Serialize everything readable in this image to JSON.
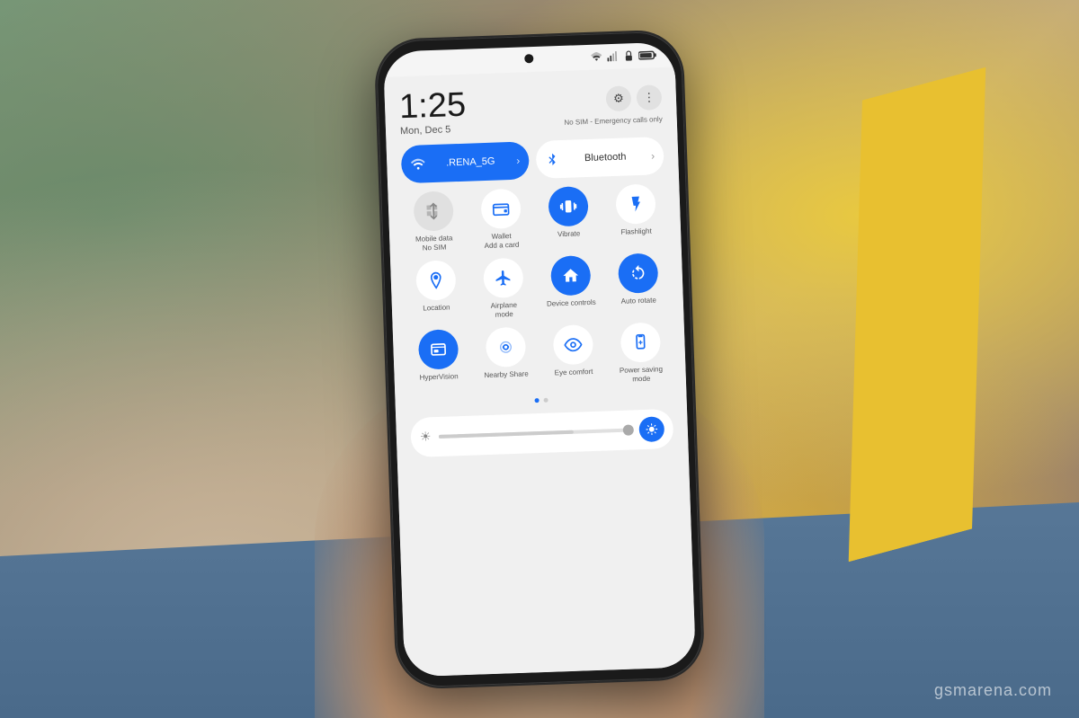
{
  "background": {
    "colors": {
      "main": "#7a8a70",
      "yellow": "#e8c030",
      "blue_floor": "#5a7a9a",
      "hand": "#c8a888"
    }
  },
  "watermark": {
    "text": "gsmarena.com"
  },
  "phone": {
    "status_bar": {
      "icons": [
        "wifi",
        "signal",
        "lock",
        "battery"
      ]
    },
    "quick_settings": {
      "time": "1:25",
      "date": "Mon, Dec 5",
      "sim_info": "No SIM - Emergency calls only",
      "settings_label": "⚙",
      "menu_label": "⋮",
      "wifi_toggle": {
        "label": ".RENA_5G",
        "active": true,
        "has_chevron": true
      },
      "bluetooth_toggle": {
        "label": "Bluetooth",
        "active": false,
        "has_chevron": true
      },
      "actions": [
        {
          "icon": "mobile_data",
          "label": "Mobile data\nNo SIM",
          "active": false,
          "gray": true
        },
        {
          "icon": "wallet",
          "label": "Wallet\nAdd a card",
          "active": false,
          "gray": false
        },
        {
          "icon": "vibrate",
          "label": "Vibrate",
          "active": true,
          "gray": false
        },
        {
          "icon": "flashlight",
          "label": "Flashlight",
          "active": false,
          "gray": false
        },
        {
          "icon": "location",
          "label": "Location",
          "active": false,
          "gray": false
        },
        {
          "icon": "airplane",
          "label": "Airplane\nmode",
          "active": false,
          "gray": false
        },
        {
          "icon": "device_controls",
          "label": "Device controls",
          "active": true,
          "gray": false
        },
        {
          "icon": "auto_rotate",
          "label": "Auto rotate",
          "active": true,
          "gray": false
        },
        {
          "icon": "hypervision",
          "label": "HyperVision",
          "active": true,
          "gray": false
        },
        {
          "icon": "nearby_share",
          "label": "Nearby Share",
          "active": false,
          "gray": false
        },
        {
          "icon": "eye_comfort",
          "label": "Eye comfort",
          "active": false,
          "gray": false
        },
        {
          "icon": "power_saving",
          "label": "Power saving\nmode",
          "active": false,
          "gray": false
        }
      ],
      "page_dots": [
        {
          "active": true
        },
        {
          "active": false
        }
      ],
      "brightness": {
        "level": 70
      }
    }
  }
}
